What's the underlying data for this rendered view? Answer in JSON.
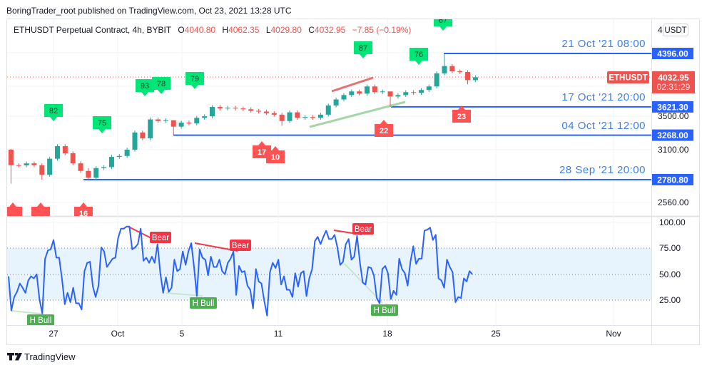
{
  "header": {
    "published": "BoringTrader_root published on TradingView.com, Oct 23, 2021 13:28 UTC"
  },
  "legend": {
    "symbol": "ETHUSDT Perpetual Contract, 4h, BYBIT",
    "o_label": "O",
    "o": "4040.80",
    "h_label": "H",
    "h": "4062.35",
    "l_label": "L",
    "l": "4029.80",
    "c_label": "C",
    "c": "4032.95",
    "change": "−7.85 (−0.19%)"
  },
  "price_axis": {
    "currency": "USDT",
    "partial_tick": "4",
    "ticks": [
      "3500.00",
      "3100.00",
      "2560.00"
    ],
    "last_price": "4032.95",
    "countdown": "02:31:29",
    "symbol_tag": "ETHUSDT"
  },
  "rsi_axis": {
    "ticks": [
      "100.00",
      "75.00",
      "50.00",
      "25.00"
    ]
  },
  "time_axis": {
    "ticks": [
      "27",
      "Oct",
      "5",
      "11",
      "18",
      "25",
      "Nov"
    ]
  },
  "footer": {
    "brand": "TradingView"
  },
  "colors": {
    "up": "#26a69a",
    "down": "#ef5350",
    "level": "#2962ff",
    "rsi": "#2962ff",
    "bull_marker": "#00e676",
    "bear_marker": "#ff5252",
    "bull_div": "#4caf50",
    "bear_div": "#f23645"
  },
  "chart_data": {
    "type": "candlestick",
    "interval": "4h",
    "scale": "log",
    "grid": true,
    "open_first": 3100,
    "closes_12h": [
      2930,
      2929,
      2950,
      2930,
      2830,
      3000,
      3140,
      3060,
      2950,
      2870,
      2800,
      2900,
      2910,
      3020,
      3030,
      3100,
      3300,
      3230,
      3460,
      3440,
      3450,
      3370,
      3420,
      3410,
      3480,
      3500,
      3620,
      3600,
      3610,
      3600,
      3590,
      3570,
      3560,
      3540,
      3520,
      3440,
      3550,
      3480,
      3490,
      3480,
      3520,
      3640,
      3720,
      3780,
      3830,
      3800,
      3900,
      3820,
      3830,
      3760,
      3780,
      3820,
      3810,
      3850,
      3900,
      4090,
      4200,
      4120,
      4110,
      3990,
      4033
    ],
    "levels": [
      {
        "price": "4396.00",
        "label": "21 Oct '21 08:00"
      },
      {
        "price": "3621.30",
        "label": "17 Oct '21 20:00"
      },
      {
        "price": "3268.00",
        "label": "04 Oct '21 12:00"
      },
      {
        "price": "2780.80",
        "label": "28 Sep '21 20:00"
      }
    ],
    "bull_markers": [
      "82",
      "75",
      "93",
      "78",
      "79",
      "87",
      "76",
      "67"
    ],
    "bear_markers": [
      "17",
      "10",
      "22",
      "23",
      "16",
      "",
      ""
    ],
    "rsi": {
      "ylim": [
        0,
        100
      ],
      "band": [
        25,
        75
      ],
      "values": [
        48,
        15,
        28,
        33,
        41,
        37,
        32,
        44,
        48,
        46,
        50,
        26,
        12,
        65,
        73,
        74,
        83,
        66,
        66,
        46,
        21,
        32,
        23,
        37,
        22,
        22,
        16,
        53,
        61,
        62,
        38,
        28,
        39,
        76,
        72,
        57,
        61,
        65,
        66,
        85,
        94,
        94,
        96,
        96,
        74,
        76,
        79,
        94,
        63,
        66,
        61,
        67,
        61,
        79,
        51,
        32,
        47,
        33,
        37,
        64,
        53,
        55,
        72,
        59,
        72,
        80,
        57,
        29,
        74,
        66,
        64,
        49,
        67,
        57,
        57,
        64,
        53,
        50,
        61,
        65,
        72,
        30,
        58,
        52,
        53,
        39,
        35,
        17,
        55,
        43,
        41,
        24,
        10,
        52,
        61,
        56,
        64,
        40,
        48,
        35,
        35,
        28,
        51,
        38,
        51,
        53,
        29,
        46,
        55,
        82,
        86,
        79,
        86,
        92,
        84,
        84,
        88,
        76,
        59,
        62,
        79,
        84,
        64,
        67,
        87,
        62,
        42,
        40,
        57,
        56,
        49,
        27,
        22,
        55,
        58,
        51,
        26,
        34,
        30,
        65,
        55,
        51,
        39,
        62,
        77,
        60,
        65,
        65,
        92,
        93,
        95,
        83,
        88,
        46,
        44,
        37,
        64,
        57,
        52,
        23,
        28,
        27,
        46,
        43,
        53,
        50
      ],
      "divergence_labels": [
        "Bear",
        "Bear",
        "Bear",
        "H Bull",
        "H Bull",
        "H Bull"
      ]
    }
  }
}
